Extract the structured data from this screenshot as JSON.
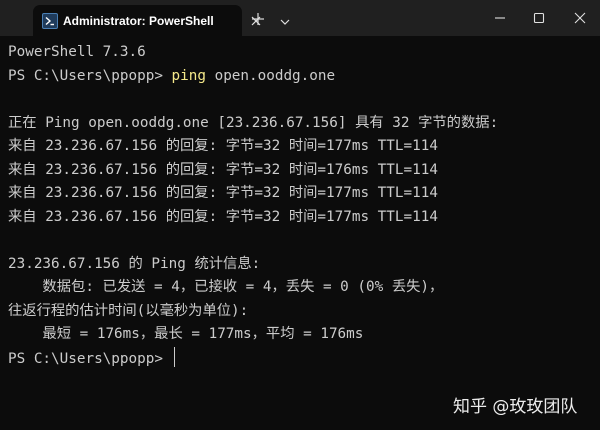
{
  "titlebar": {
    "tab_title": "Administrator: PowerShell",
    "icons": {
      "tab_icon": "powershell-icon",
      "tab_close": "close-icon",
      "new_tab": "plus-icon",
      "dropdown": "chevron-down-icon",
      "minimize": "minimize-icon",
      "maximize": "maximize-icon",
      "close": "close-icon"
    }
  },
  "terminal": {
    "version_line": "PowerShell 7.3.6",
    "prompt1": {
      "path": "PS C:\\Users\\ppopp> ",
      "command": "ping",
      "argument": " open.ooddg.one"
    },
    "ping_header": "正在 Ping open.ooddg.one [23.236.67.156] 具有 32 字节的数据:",
    "replies": [
      "来自 23.236.67.156 的回复: 字节=32 时间=177ms TTL=114",
      "来自 23.236.67.156 的回复: 字节=32 时间=176ms TTL=114",
      "来自 23.236.67.156 的回复: 字节=32 时间=177ms TTL=114",
      "来自 23.236.67.156 的回复: 字节=32 时间=177ms TTL=114"
    ],
    "stats_header": "23.236.67.156 的 Ping 统计信息:",
    "packets_line": "    数据包: 已发送 = 4，已接收 = 4，丢失 = 0 (0% 丢失)，",
    "rtt_header": "往返行程的估计时间(以毫秒为单位):",
    "rtt_line": "    最短 = 176ms，最长 = 177ms，平均 = 176ms",
    "prompt2": "PS C:\\Users\\ppopp> "
  },
  "watermark": "知乎 @玫玫团队",
  "colors": {
    "background": "#0c0c0c",
    "titlebar": "#202020",
    "text": "#cccccc",
    "command": "#f5e98a"
  }
}
